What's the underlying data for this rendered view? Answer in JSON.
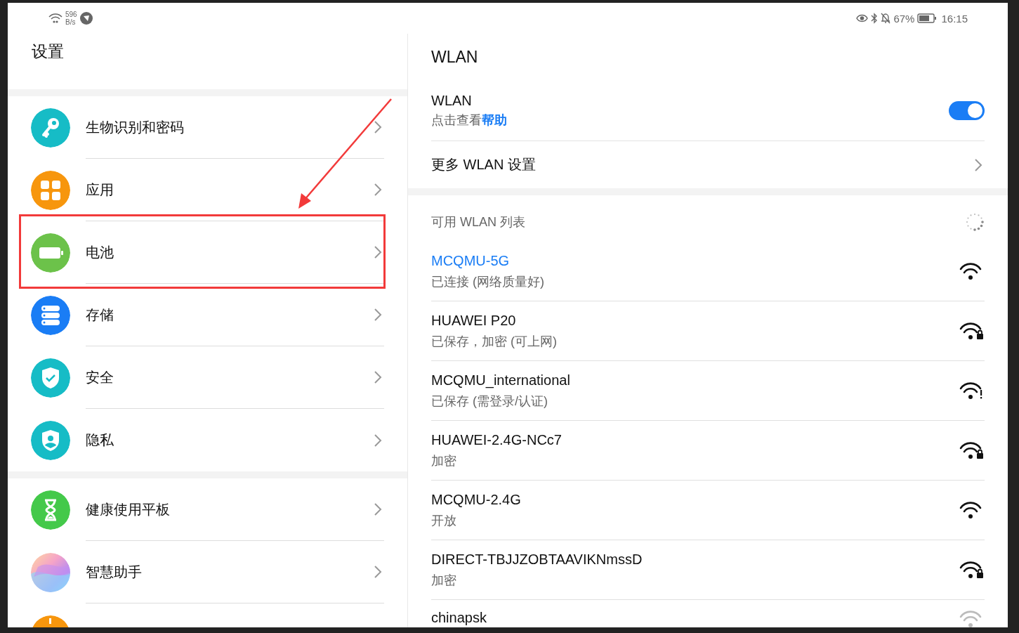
{
  "status_bar": {
    "speed_value": "596",
    "speed_unit": "B/s",
    "battery_percent": "67%",
    "time": "16:15"
  },
  "settings": {
    "title": "设置",
    "groups": [
      {
        "items": [
          {
            "label": "生物识别和密码",
            "kind": "key",
            "color": "#16bcc6",
            "highlighted": false
          },
          {
            "label": "应用",
            "kind": "apps",
            "color": "#f7960d",
            "highlighted": false
          },
          {
            "label": "电池",
            "kind": "battery",
            "color": "#6cc24a",
            "highlighted": true
          },
          {
            "label": "存储",
            "kind": "storage",
            "color": "#1a7df5",
            "highlighted": false
          },
          {
            "label": "安全",
            "kind": "shield",
            "color": "#16bcc6",
            "highlighted": false
          },
          {
            "label": "隐私",
            "kind": "privacy",
            "color": "#16bcc6",
            "highlighted": false
          }
        ]
      },
      {
        "items": [
          {
            "label": "健康使用平板",
            "kind": "hourglass",
            "color": "#44c94a",
            "highlighted": false
          },
          {
            "label": "智慧助手",
            "kind": "assistant",
            "highlighted": false
          },
          {
            "kind": "dot",
            "color": "#f7960d",
            "highlighted": false
          }
        ]
      }
    ]
  },
  "wlan": {
    "title": "WLAN",
    "switch": {
      "label": "WLAN",
      "hint": "点击查看**帮助**",
      "on": true
    },
    "more": "更多 WLAN 设置",
    "list_title": "可用 WLAN 列表",
    "networks": [
      {
        "name": "MCQMU-5G",
        "status": "已连接 (网络质量好)",
        "connected": true,
        "kind": "open"
      },
      {
        "name": "HUAWEI P20",
        "status": "已保存，加密 (可上网)",
        "connected": false,
        "kind": "lock"
      },
      {
        "name": "MCQMU_international",
        "status": "已保存 (需登录/认证)",
        "connected": false,
        "kind": "alert"
      },
      {
        "name": "HUAWEI-2.4G-NCc7",
        "status": "加密",
        "connected": false,
        "kind": "lock"
      },
      {
        "name": "MCQMU-2.4G",
        "status": "开放",
        "connected": false,
        "kind": "open"
      },
      {
        "name": "DIRECT-TBJJZOBTAAVIKNmssD",
        "status": "加密",
        "connected": false,
        "kind": "lock"
      },
      {
        "name": "chinapsk",
        "connected": false,
        "kind": "open"
      }
    ]
  }
}
